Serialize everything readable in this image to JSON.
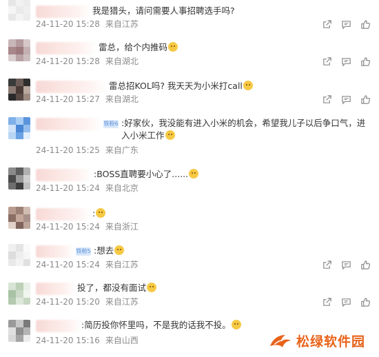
{
  "comments": [
    {
      "text": "我是猎头，请问需要人事招聘选手吗?",
      "date": "24-11-20 15:28",
      "location": "来自江苏",
      "show_actions": true,
      "avatar_colors": [
        "#e6e6e6",
        "#f2f2f2",
        "#ececec",
        "#f5f5f5",
        "#eaeaea",
        "#f0f0f0",
        "#e8e8e8",
        "#f4f4f4",
        "#ededed"
      ]
    },
    {
      "text": "雷总，给个内推码",
      "date": "24-11-20 15:28",
      "location": "来自湖北",
      "show_actions": true,
      "avatar_colors": [
        "#c8b6b8",
        "#b59a9d",
        "#d6c8c9",
        "#a8878a",
        "#9c7a7e",
        "#c4b0b2",
        "#d9cdce",
        "#b9a2a5",
        "#cdbfc0"
      ]
    },
    {
      "text": "雷总招KOL吗? 我天天为小米打call",
      "date": "24-11-20 15:27",
      "location": "来自湖北",
      "show_actions": true,
      "avatar_colors": [
        "#3a3a3a",
        "#6b5a55",
        "#2e2e2e",
        "#8a7a72",
        "#4a3a35",
        "#b8a89e",
        "#2a2a2a",
        "#5a4a45",
        "#9a8a80"
      ]
    },
    {
      "badge": "铁粉6",
      "text": ":好家伙，我没能有进入小米的机会，希望我儿子以后争口气，进入小米工作",
      "date": "24-11-20 15:25",
      "location": "来自广东",
      "show_actions": true,
      "avatar_colors": [
        "#7fb0e8",
        "#a9cdf3",
        "#5a94dd",
        "#cfe2f8",
        "#4a86d6",
        "#93bdec",
        "#b9d5f5",
        "#6aa2e3",
        "#e2eefb"
      ]
    },
    {
      "text": ":BOSS直聘要小心了......",
      "date": "24-11-20 15:24",
      "location": "来自北京",
      "show_actions": true,
      "avatar_colors": [
        "#8a8a8a",
        "#5e5e5e",
        "#b0b0b0",
        "#4a4a4a",
        "#9a9a9a",
        "#d0d0d0",
        "#6e6e6e",
        "#3e3e3e",
        "#c0c0c0"
      ]
    },
    {
      "text": ":",
      "date": "24-11-20 15:24",
      "location": "来自浙江",
      "show_actions": true,
      "avatar_colors": [
        "#b89a8e",
        "#9c8075",
        "#d1bcb2",
        "#8a6e64",
        "#c4a89c",
        "#a8918a",
        "#e0d0c8",
        "#7e645b",
        "#bfa69b"
      ]
    },
    {
      "badge": "铁粉5",
      "text": ":想去",
      "date": "24-11-20 15:24",
      "location": "来自江苏",
      "show_actions": true,
      "avatar_colors": [
        "#f0f0f0",
        "#e4e4e4",
        "#fafafa",
        "#dcdcdc",
        "#eeeeee",
        "#f6f6f6",
        "#e9e9e9",
        "#f3f3f3",
        "#e0e0e0"
      ]
    },
    {
      "text": "投了，都没有面试",
      "date": "24-11-20 15:20",
      "location": "来自江苏",
      "show_actions": true,
      "avatar_colors": [
        "#d8e4d6",
        "#bcd1b8",
        "#e9f0e7",
        "#a9c2a4",
        "#cbdac8",
        "#f0f5ef",
        "#b4c9b0",
        "#dde8db",
        "#c6d6c2"
      ]
    },
    {
      "text": ":简历投你怀里吗，不是我的话我不投。",
      "date": "24-11-20 15:16",
      "location": "来自山西",
      "show_actions": false,
      "avatar_colors": [
        "#9a9a9a",
        "#c8c8c8",
        "#7a7a7a",
        "#e0e0e0",
        "#8e8e8e",
        "#b4b4b4",
        "#d8d8d8",
        "#a4a4a4",
        "#ececec"
      ]
    }
  ],
  "watermark": {
    "text": "松绿软件园"
  }
}
